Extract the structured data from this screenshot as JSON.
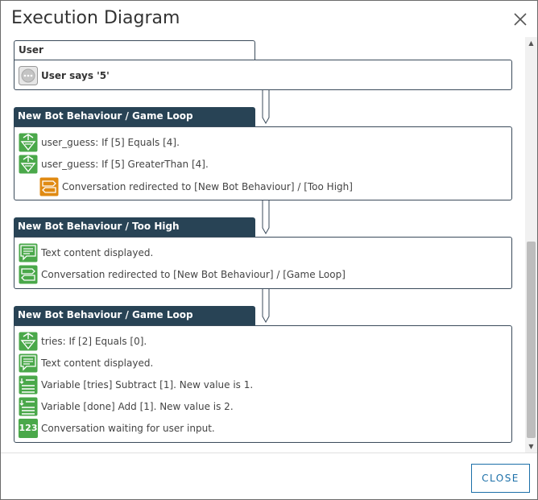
{
  "dialog": {
    "title": "Execution Diagram",
    "close_icon": "close-x-icon",
    "close_button_label": "CLOSE"
  },
  "colors": {
    "header_dark": "#284355",
    "icon_green": "#4aa84a",
    "icon_orange": "#e08a12",
    "button_blue": "#1b6fa8"
  },
  "blocks": [
    {
      "title": "User",
      "style": "light",
      "rows": [
        {
          "icon": "user-chat-icon",
          "text": "User says '5'"
        }
      ]
    },
    {
      "title": "New Bot Behaviour / Game Loop",
      "style": "dark",
      "rows": [
        {
          "icon": "condition-icon",
          "text": "user_guess: If [5] Equals [4]."
        },
        {
          "icon": "condition-icon",
          "text": "user_guess: If [5] GreaterThan [4]."
        },
        {
          "icon": "redirect-icon",
          "text": "Conversation redirected to [New Bot Behaviour] / [Too High]"
        }
      ]
    },
    {
      "title": "New Bot Behaviour / Too High",
      "style": "dark",
      "rows": [
        {
          "icon": "text-content-icon",
          "text": "Text content displayed."
        },
        {
          "icon": "redirect-icon",
          "text": "Conversation redirected to [New Bot Behaviour] / [Game Loop]"
        }
      ]
    },
    {
      "title": "New Bot Behaviour / Game Loop",
      "style": "dark",
      "rows": [
        {
          "icon": "condition-icon",
          "text": "tries: If [2] Equals [0]."
        },
        {
          "icon": "text-content-icon",
          "text": "Text content displayed."
        },
        {
          "icon": "variable-icon",
          "text": "Variable [tries] Subtract [1]. New value is 1."
        },
        {
          "icon": "variable-icon",
          "text": "Variable [done] Add [1]. New value is 2."
        },
        {
          "icon": "numeric-input-icon",
          "text": "Conversation waiting for user input.",
          "glyph": "123"
        }
      ]
    }
  ]
}
